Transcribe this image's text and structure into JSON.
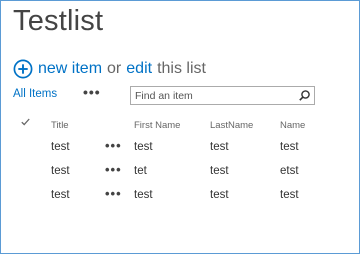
{
  "page": {
    "title": "Testlist"
  },
  "actions": {
    "new_item": "new item",
    "or": "or",
    "edit": "edit",
    "this_list": "this list"
  },
  "views": {
    "current_view": "All Items",
    "more": "•••"
  },
  "search": {
    "placeholder": "Find an item",
    "value": ""
  },
  "list": {
    "columns": [
      "Title",
      "First Name",
      "LastName",
      "Name"
    ],
    "row_menu": "•••",
    "rows": [
      {
        "title": "test",
        "first_name": "test",
        "last_name": "test",
        "name": "test"
      },
      {
        "title": "test",
        "first_name": "tet",
        "last_name": "test",
        "name": "etst"
      },
      {
        "title": "test",
        "first_name": "test",
        "last_name": "test",
        "name": "test"
      }
    ]
  },
  "colors": {
    "accent": "#0072c6",
    "frame_border": "#5b9bd5",
    "title_text": "#444444",
    "muted_text": "#666666"
  },
  "icons": {
    "new_item": "plus-circle-icon",
    "search": "search-icon",
    "select_all": "checkmark-icon"
  }
}
